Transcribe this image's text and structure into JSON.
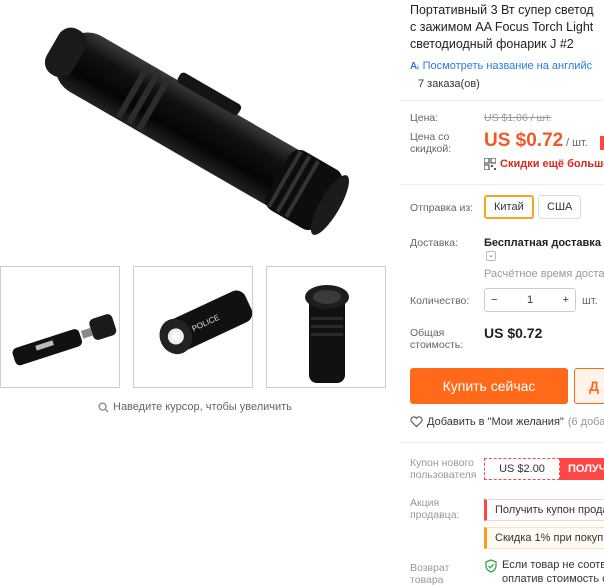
{
  "gallery": {
    "zoom_hint": "Наведите курсор, чтобы увеличить",
    "thumb_label_text": "POLICE"
  },
  "product": {
    "title_lines": [
      "Портативный 3 Вт супер светод",
      "с зажимом AA Focus Torch Light",
      "светодиодный фонарик J #2"
    ],
    "translate_link": "Посмотреть название на английс",
    "orders": "7 заказа(ов)"
  },
  "price": {
    "price_label": "Цена:",
    "old_price": "US $1.06 / шт.",
    "sale_label_1": "Цена со",
    "sale_label_2": "скидкой:",
    "new_price": "US $0.72",
    "per_unit": "/ шт.",
    "discount_text": "Скидки ещё больше"
  },
  "shipping": {
    "ship_from_label": "Отправка из:",
    "options": [
      "Китай",
      "США"
    ],
    "selected": "Китай",
    "delivery_label": "Доставка:",
    "delivery_value": "Бесплатная доставка в",
    "delivery_estimate": "Расчётное время доставк"
  },
  "quantity": {
    "label": "Количество:",
    "value": "1",
    "minus": "−",
    "plus": "+",
    "unit": "шт."
  },
  "total": {
    "label_1": "Общая",
    "label_2": "стоимость:",
    "value": "US $0.72"
  },
  "actions": {
    "buy_now": "Купить сейчас",
    "add_to_cart_partial": "Д",
    "wishlist": "Добавить в \"Мои желания\"",
    "wishlist_count": "(6 доба"
  },
  "coupons": {
    "new_user_label_1": "Купон нового",
    "new_user_label_2": "пользователя",
    "coupon_value": "US $2.00",
    "get_coupon": "ПОЛУЧЧ",
    "seller_promo_label_1": "Акция",
    "seller_promo_label_2": "продавца:",
    "promo_1": "Получить купон прода",
    "promo_2": "Скидка 1% при покуп"
  },
  "returns": {
    "label_1": "Возврат",
    "label_2": "товара",
    "text_1": "Если товар не соотв",
    "text_2": "оплатив стоимость с"
  },
  "colors": {
    "accent": "#ff6a1a",
    "price": "#f05a22",
    "selected_border": "#f5a623",
    "link": "#2a7ae4"
  }
}
